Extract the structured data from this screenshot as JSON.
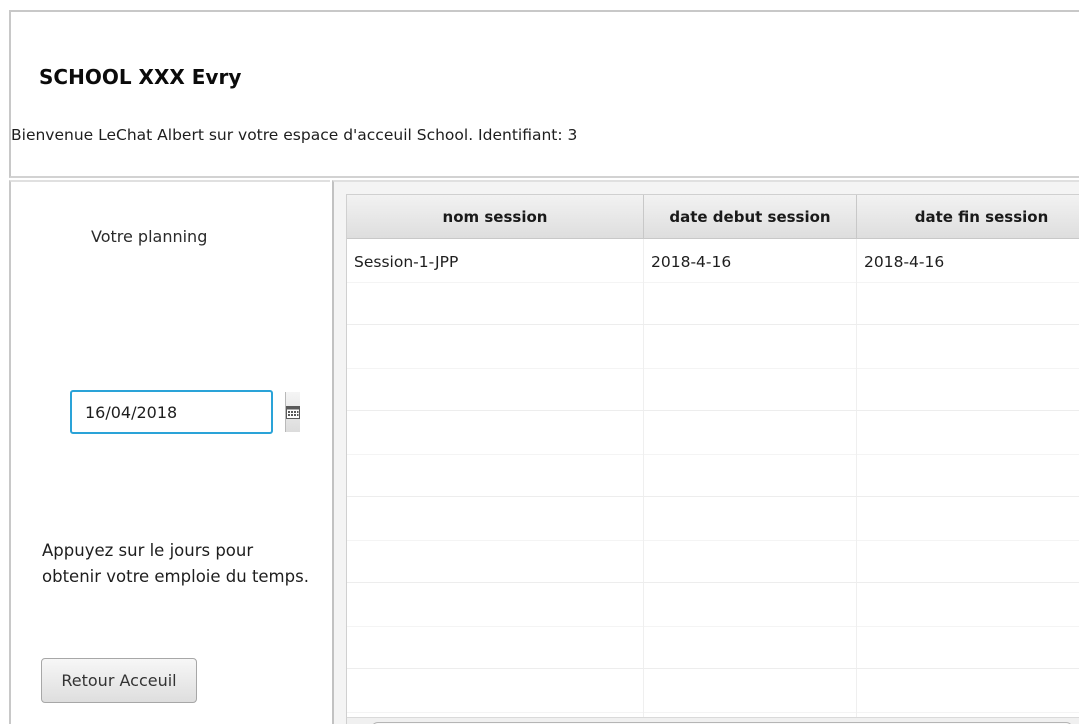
{
  "header": {
    "title": "SCHOOL XXX Evry",
    "welcome": "Bienvenue LeChat Albert sur votre espace d'acceuil School. Identifiant: 3"
  },
  "left": {
    "planning_label": "Votre planning",
    "date_value": "16/04/2018",
    "calendar_icon": "calendar-icon",
    "instructions": "Appuyez sur le jours pour obtenir votre emploie du temps.",
    "back_button": "Retour Acceuil"
  },
  "table": {
    "columns": [
      "nom session",
      "date debut session",
      "date fin session"
    ],
    "rows": [
      [
        "Session-1-JPP",
        "2018-4-16",
        "2018-4-16"
      ]
    ]
  },
  "colors": {
    "focus_border": "#2aa3d8"
  }
}
